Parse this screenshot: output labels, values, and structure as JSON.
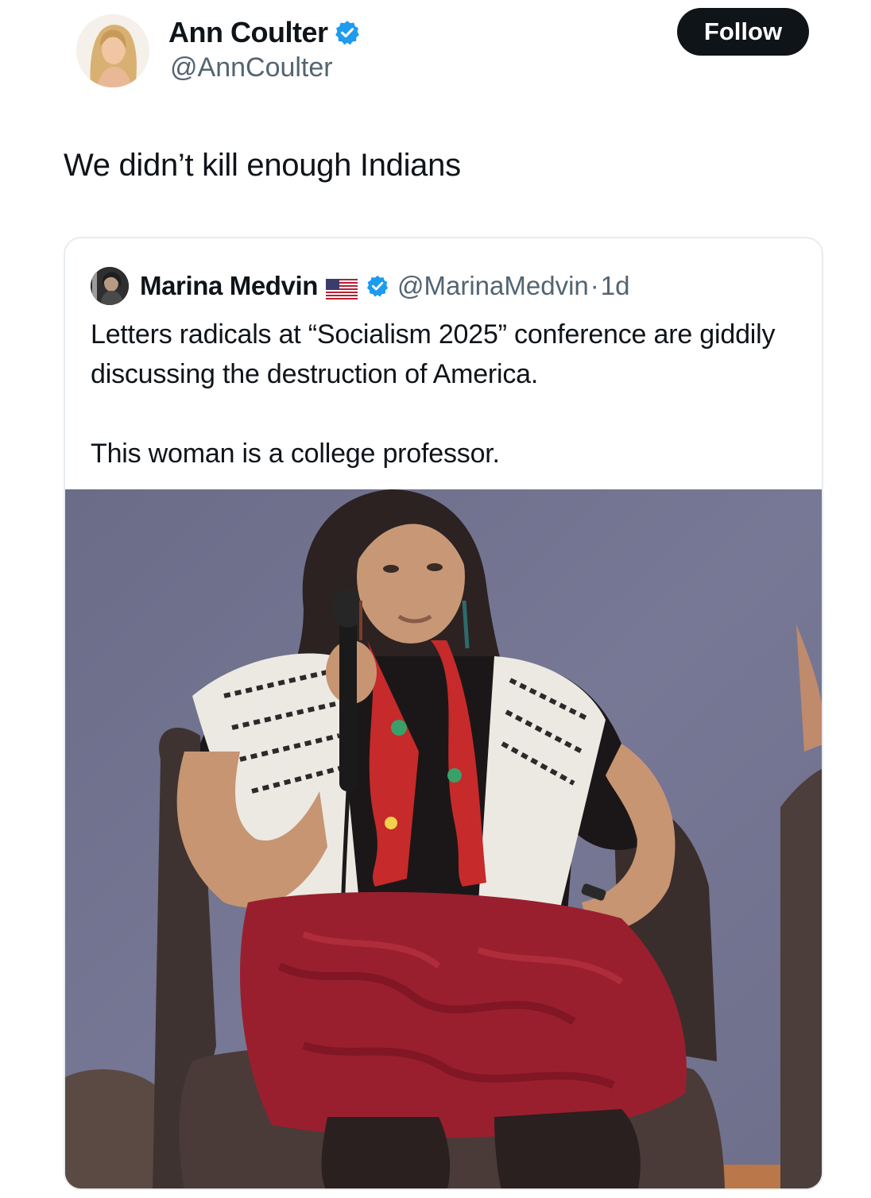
{
  "tweet": {
    "author": {
      "name": "Ann Coulter",
      "handle": "@AnnCoulter",
      "verified": true
    },
    "follow_label": "Follow",
    "text": "We didn’t kill enough Indians",
    "quoted": {
      "author_name": "Marina Medvin",
      "flag_icon": "us-flag-icon",
      "verified": true,
      "handle": "@MarinaMedvin",
      "separator": "·",
      "time": "1d",
      "paragraphs": [
        "Letters radicals at “Socialism 2025” conference are giddily discussing the destruction of America.",
        "This woman is a college professor."
      ]
    }
  },
  "colors": {
    "verified_badge": "#1d9bf0",
    "follow_button": "#0f1419",
    "secondary_text": "#536471",
    "photo_backdrop": "#727390",
    "skirt": "#9a1f2e",
    "scarf": "#c62a2a"
  }
}
